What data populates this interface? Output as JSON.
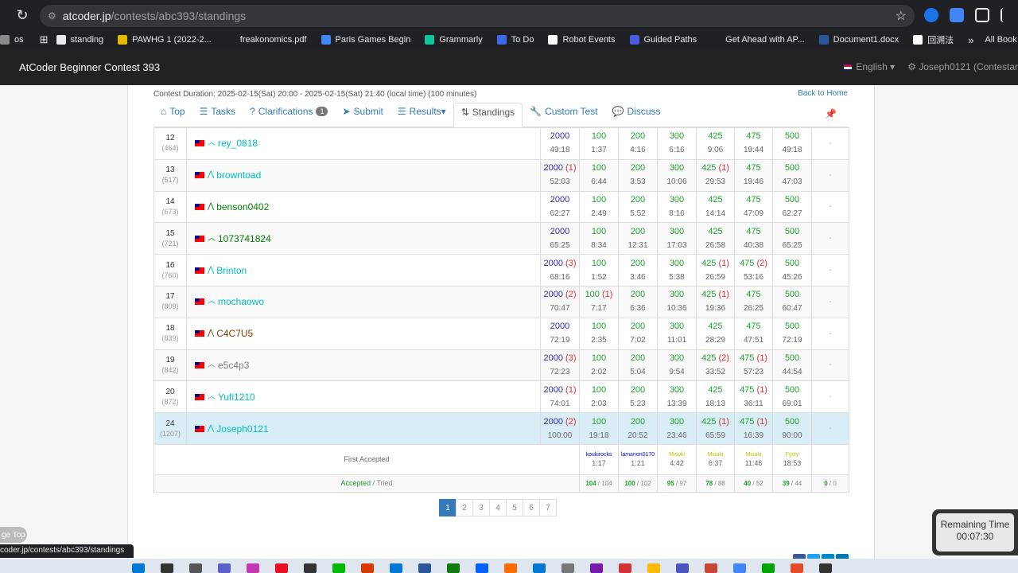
{
  "browser": {
    "url_host": "atcoder.jp",
    "url_path": "/contests/abc393/standings",
    "bookmarks": [
      {
        "label": "os",
        "color": "#888888"
      },
      {
        "label": "standing",
        "color": "#e8eaed"
      },
      {
        "label": "PAWHG 1 (2022-2...",
        "color": "#e5b800"
      },
      {
        "label": "freakonomics.pdf",
        "color": "#202124"
      },
      {
        "label": "Paris Games Begin",
        "color": "#4285f4"
      },
      {
        "label": "Grammarly",
        "color": "#15c39a"
      },
      {
        "label": "To Do",
        "color": "#3e69e4"
      },
      {
        "label": "Robot Events",
        "color": "#ffffff"
      },
      {
        "label": "Guided Paths",
        "color": "#4a5bdc"
      },
      {
        "label": "Get Ahead with AP...",
        "color": "#202124"
      },
      {
        "label": "Document1.docx",
        "color": "#2b579a"
      },
      {
        "label": "回溯法",
        "color": "#ffffff"
      }
    ],
    "all_bookmarks": "All Book"
  },
  "navbar": {
    "title": "AtCoder Beginner Contest 393",
    "language": "English",
    "user": "Joseph0121 (Contestar"
  },
  "contest": {
    "duration": "Contest Duration: 2025-02-15(Sat) 20:00 - 2025-02-15(Sat) 21:40 (local time) (100 minutes)",
    "back_home": "Back to Home"
  },
  "tabs": [
    {
      "label": "Top",
      "icon": "home-icon",
      "glyph": "⌂"
    },
    {
      "label": "Tasks",
      "icon": "list-icon",
      "glyph": "☰"
    },
    {
      "label": "Clarifications",
      "icon": "question-icon",
      "glyph": "?",
      "badge": "1"
    },
    {
      "label": "Submit",
      "icon": "send-icon",
      "glyph": "➤"
    },
    {
      "label": "Results",
      "icon": "list-icon",
      "glyph": "☰",
      "dropdown": true
    },
    {
      "label": "Standings",
      "icon": "sort-icon",
      "glyph": "⇅",
      "active": true
    },
    {
      "label": "Custom Test",
      "icon": "wrench-icon",
      "glyph": "🔧"
    },
    {
      "label": "Discuss",
      "icon": "comment-icon",
      "glyph": "💬"
    }
  ],
  "rows": [
    {
      "rank": "12",
      "perf": "(464)",
      "name": "rey_0818",
      "color": "c-cyan",
      "chev": "︿",
      "total": "2000",
      "total_pen": "",
      "total_time": "49:18",
      "problems": [
        [
          "100",
          "",
          "1:37"
        ],
        [
          "200",
          "",
          "4:16"
        ],
        [
          "300",
          "",
          "6:16"
        ],
        [
          "425",
          "",
          "9:06"
        ],
        [
          "475",
          "",
          "19:44"
        ],
        [
          "500",
          "",
          "49:18"
        ]
      ]
    },
    {
      "rank": "13",
      "perf": "(517)",
      "name": "browntoad",
      "color": "c-cyan",
      "chev": "⋀",
      "total": "2000",
      "total_pen": "(1)",
      "total_time": "52:03",
      "problems": [
        [
          "100",
          "",
          "6:44"
        ],
        [
          "200",
          "",
          "3:53"
        ],
        [
          "300",
          "",
          "10:06"
        ],
        [
          "425",
          "(1)",
          "29:53"
        ],
        [
          "475",
          "",
          "19:46"
        ],
        [
          "500",
          "",
          "47:03"
        ]
      ]
    },
    {
      "rank": "14",
      "perf": "(673)",
      "name": "benson0402",
      "color": "c-green",
      "chev": "⋀",
      "total": "2000",
      "total_pen": "",
      "total_time": "62:27",
      "problems": [
        [
          "100",
          "",
          "2:49"
        ],
        [
          "200",
          "",
          "5:52"
        ],
        [
          "300",
          "",
          "8:16"
        ],
        [
          "425",
          "",
          "14:14"
        ],
        [
          "475",
          "",
          "47:09"
        ],
        [
          "500",
          "",
          "62:27"
        ]
      ]
    },
    {
      "rank": "15",
      "perf": "(721)",
      "name": "1073741824",
      "color": "c-green",
      "chev": "︿",
      "total": "2000",
      "total_pen": "",
      "total_time": "65:25",
      "problems": [
        [
          "100",
          "",
          "8:34"
        ],
        [
          "200",
          "",
          "12:31"
        ],
        [
          "300",
          "",
          "17:03"
        ],
        [
          "425",
          "",
          "26:58"
        ],
        [
          "475",
          "",
          "40:38"
        ],
        [
          "500",
          "",
          "65:25"
        ]
      ]
    },
    {
      "rank": "16",
      "perf": "(760)",
      "name": "Brinton",
      "color": "c-cyan",
      "chev": "⋀",
      "total": "2000",
      "total_pen": "(3)",
      "total_time": "68:16",
      "problems": [
        [
          "100",
          "",
          "1:52"
        ],
        [
          "200",
          "",
          "3:46"
        ],
        [
          "300",
          "",
          "5:38"
        ],
        [
          "425",
          "(1)",
          "26:59"
        ],
        [
          "475",
          "(2)",
          "53:16"
        ],
        [
          "500",
          "",
          "45:26"
        ]
      ]
    },
    {
      "rank": "17",
      "perf": "(809)",
      "name": "mochaowo",
      "color": "c-cyan",
      "chev": "︿",
      "total": "2000",
      "total_pen": "(2)",
      "total_time": "70:47",
      "problems": [
        [
          "100",
          "(1)",
          "7:17"
        ],
        [
          "200",
          "",
          "6:36"
        ],
        [
          "300",
          "",
          "10:36"
        ],
        [
          "425",
          "(1)",
          "19:36"
        ],
        [
          "475",
          "",
          "26:25"
        ],
        [
          "500",
          "",
          "60:47"
        ]
      ]
    },
    {
      "rank": "18",
      "perf": "(839)",
      "name": "C4C7U5",
      "color": "c-brown",
      "chev": "⋀",
      "total": "2000",
      "total_pen": "",
      "total_time": "72:19",
      "problems": [
        [
          "100",
          "",
          "2:35"
        ],
        [
          "200",
          "",
          "7:02"
        ],
        [
          "300",
          "",
          "11:01"
        ],
        [
          "425",
          "",
          "28:29"
        ],
        [
          "475",
          "",
          "47:51"
        ],
        [
          "500",
          "",
          "72:19"
        ]
      ]
    },
    {
      "rank": "19",
      "perf": "(842)",
      "name": "e5c4p3",
      "color": "c-gray",
      "chev": "︿",
      "total": "2000",
      "total_pen": "(3)",
      "total_time": "72:23",
      "problems": [
        [
          "100",
          "",
          "2:02"
        ],
        [
          "200",
          "",
          "5:04"
        ],
        [
          "300",
          "",
          "9:54"
        ],
        [
          "425",
          "(2)",
          "33:52"
        ],
        [
          "475",
          "(1)",
          "57:23"
        ],
        [
          "500",
          "",
          "44:54"
        ]
      ]
    },
    {
      "rank": "20",
      "perf": "(872)",
      "name": "Yufi1210",
      "color": "c-cyan",
      "chev": "︿",
      "total": "2000",
      "total_pen": "(1)",
      "total_time": "74:01",
      "problems": [
        [
          "100",
          "",
          "2:03"
        ],
        [
          "200",
          "",
          "5:23"
        ],
        [
          "300",
          "",
          "13:39"
        ],
        [
          "425",
          "",
          "18:13"
        ],
        [
          "475",
          "(1)",
          "36:11"
        ],
        [
          "500",
          "",
          "69:01"
        ]
      ]
    },
    {
      "rank": "24",
      "perf": "(1207)",
      "name": "Joseph0121",
      "color": "c-cyan",
      "chev": "⋀",
      "total": "2000",
      "total_pen": "(2)",
      "total_time": "100:00",
      "me": true,
      "problems": [
        [
          "100",
          "",
          "19:18"
        ],
        [
          "200",
          "",
          "20:52"
        ],
        [
          "300",
          "",
          "23:46"
        ],
        [
          "425",
          "(1)",
          "65:59"
        ],
        [
          "475",
          "(1)",
          "16:39"
        ],
        [
          "500",
          "",
          "90:00"
        ]
      ]
    }
  ],
  "first_accepted": {
    "label": "First Accepted",
    "cells": [
      {
        "name": "koukirocks",
        "color": "c-blue",
        "time": "1:17"
      },
      {
        "name": "lamanon0170",
        "color": "c-blue",
        "time": "1:21"
      },
      {
        "name": "Misuki",
        "color": "c-yellow",
        "time": "4:42"
      },
      {
        "name": "Misuki",
        "color": "c-yellow",
        "time": "6:37"
      },
      {
        "name": "Misuki",
        "color": "c-yellow",
        "time": "11:46"
      },
      {
        "name": "Fysty",
        "color": "c-yellow",
        "time": "18:53"
      }
    ]
  },
  "accepted_tried": {
    "label_accepted": "Accepted",
    "label_tried": " / Tried",
    "cells": [
      {
        "acc": "104",
        "tried": " / 104"
      },
      {
        "acc": "100",
        "tried": " / 102"
      },
      {
        "acc": "95",
        "tried": " / 97"
      },
      {
        "acc": "78",
        "tried": " / 88"
      },
      {
        "acc": "40",
        "tried": " / 52"
      },
      {
        "acc": "39",
        "tried": " / 44"
      },
      {
        "acc": "0",
        "tried": " / 0"
      }
    ]
  },
  "pagination": [
    "1",
    "2",
    "3",
    "4",
    "5",
    "6",
    "7"
  ],
  "remaining": {
    "label": "Remaining Time",
    "value": "00:07:30"
  },
  "page_top": "ge Top",
  "status_url": "coder.jp/contests/abc393/standings",
  "dash": "-"
}
